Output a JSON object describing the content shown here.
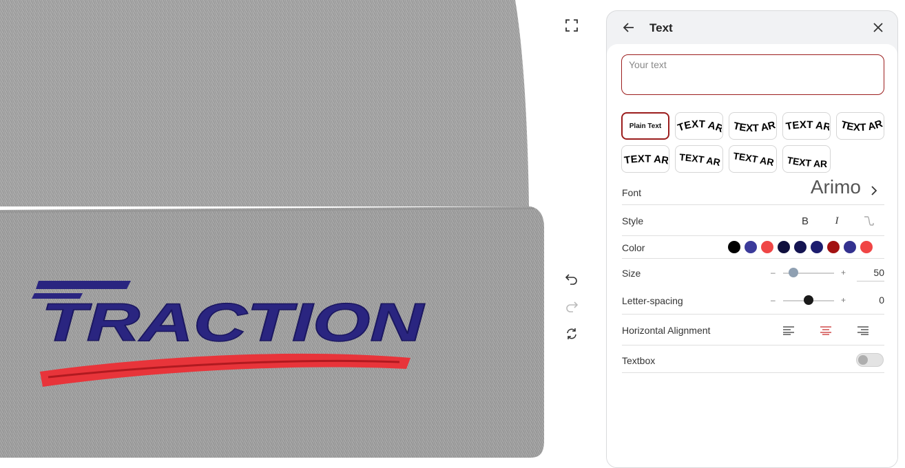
{
  "panel": {
    "title": "Text",
    "input_placeholder": "Your text",
    "input_value": ""
  },
  "text_styles": [
    {
      "label": "Plain Text",
      "selected": true
    },
    {
      "label": "TEXT ART",
      "selected": false
    },
    {
      "label": "TEXT ART",
      "selected": false
    },
    {
      "label": "TEXT ART",
      "selected": false
    },
    {
      "label": "TEXT ART",
      "selected": false
    },
    {
      "label": "TEXT ART",
      "selected": false
    },
    {
      "label": "TEXT ART",
      "selected": false
    },
    {
      "label": "TEXT ART",
      "selected": false
    },
    {
      "label": "TEXT ART",
      "selected": false
    }
  ],
  "font": {
    "label": "Font",
    "value": "Arimo"
  },
  "style": {
    "label": "Style",
    "bold": "B",
    "italic": "I"
  },
  "color": {
    "label": "Color",
    "swatches": [
      "#000000",
      "#3b3a9a",
      "#ef4646",
      "#0f0f3d",
      "#141452",
      "#1c1c6e",
      "#a31212",
      "#33318f",
      "#f04545"
    ]
  },
  "size": {
    "label": "Size",
    "minus": "–",
    "plus": "+",
    "value": "50",
    "level": 0.2
  },
  "letter_spacing": {
    "label": "Letter-spacing",
    "minus": "–",
    "plus": "+",
    "value": "0",
    "level": 0.5
  },
  "alignment": {
    "label": "Horizontal Alignment",
    "selected": "center"
  },
  "textbox": {
    "label": "Textbox",
    "enabled": false
  },
  "product": {
    "logo_text": "TRACTION",
    "logo_color": "#2a2580",
    "swoosh_color": "#e8343a"
  },
  "colors": {
    "accent": "#9b1c1c",
    "thumb": "#8fa0b2",
    "thumb_dark": "#1a1a1a"
  }
}
